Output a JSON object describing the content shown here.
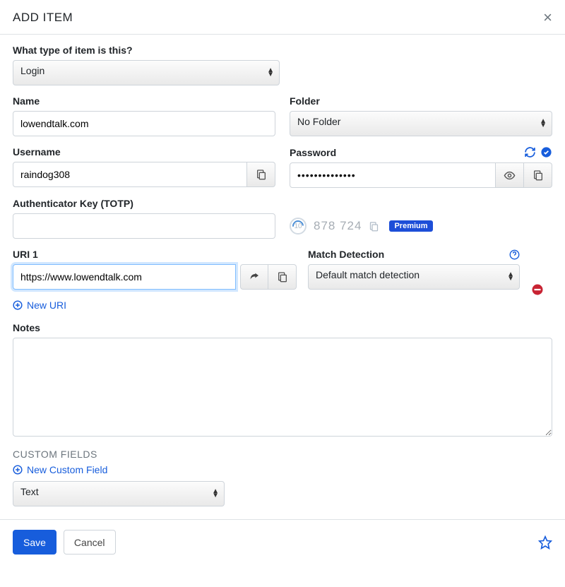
{
  "header": {
    "title": "ADD ITEM"
  },
  "typeSection": {
    "label": "What type of item is this?",
    "value": "Login"
  },
  "name": {
    "label": "Name",
    "value": "lowendtalk.com"
  },
  "folder": {
    "label": "Folder",
    "value": "No Folder"
  },
  "username": {
    "label": "Username",
    "value": "raindog308"
  },
  "password": {
    "label": "Password",
    "value": "••••••••••••••"
  },
  "totp": {
    "label": "Authenticator Key (TOTP)",
    "value": "",
    "countdown": "10",
    "code": "878  724",
    "premium": "Premium"
  },
  "uri": {
    "label": "URI 1",
    "value": "https://www.lowendtalk.com",
    "match_label": "Match Detection",
    "match_value": "Default match detection",
    "add_label": "New URI"
  },
  "notes": {
    "label": "Notes",
    "value": ""
  },
  "customFields": {
    "title": "CUSTOM FIELDS",
    "add_label": "New Custom Field",
    "type_value": "Text"
  },
  "footer": {
    "save": "Save",
    "cancel": "Cancel"
  }
}
